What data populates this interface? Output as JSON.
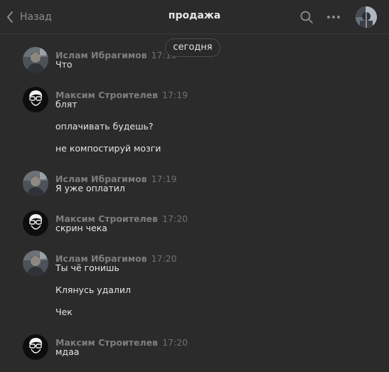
{
  "header": {
    "back_label": "Назад",
    "title": "продажа",
    "search_icon": "search-icon",
    "more_icon": "more-dots-icon"
  },
  "date_separator": "сегодня",
  "messages": [
    {
      "sender": "Ислам Ибрагимов",
      "time": "17:19",
      "avatar": "islam",
      "lines": [
        "Что"
      ]
    },
    {
      "sender": "Максим Строителев",
      "time": "17:19",
      "avatar": "maxim",
      "lines": [
        "блят",
        "оплачивать будешь?",
        "не компостируй мозги"
      ]
    },
    {
      "sender": "Ислам Ибрагимов",
      "time": "17:19",
      "avatar": "islam",
      "lines": [
        "Я уже оплатил"
      ]
    },
    {
      "sender": "Максим Строителев",
      "time": "17:20",
      "avatar": "maxim",
      "lines": [
        "скрин чека"
      ]
    },
    {
      "sender": "Ислам Ибрагимов",
      "time": "17:20",
      "avatar": "islam",
      "lines": [
        "Ты чё гонишь",
        "Клянусь удалил",
        "Чек"
      ]
    },
    {
      "sender": "Максим Строителев",
      "time": "17:20",
      "avatar": "maxim",
      "lines": [
        "мдаа"
      ]
    }
  ],
  "colors": {
    "background": "#2b2b2c",
    "sender_name": "#7d7e80",
    "message_text": "#e5e5e6"
  }
}
